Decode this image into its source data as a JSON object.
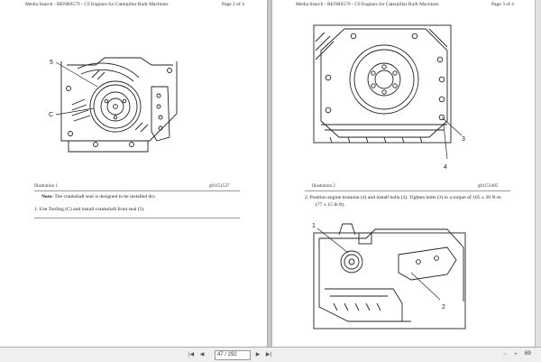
{
  "left_page": {
    "header_left": "Media Search - RENR9579 - C9 Engines for Caterpillar Built Machines",
    "header_right": "Page 2 of 4",
    "illustration": {
      "label": "Illustration 1",
      "id": "g01151537",
      "callouts": [
        "5",
        "C"
      ]
    },
    "note_label": "Note:",
    "note_text": " The crankshaft seal is designed to be installed dry.",
    "step": "1.  Use Tooling (C) and install crankshaft front seal (5)."
  },
  "right_page": {
    "header_left": "Media Search - RENR9579 - C9 Engines for Caterpillar Built Machines",
    "header_right": "Page 3 of 4",
    "illustration_top": {
      "label": "Illustration 2",
      "id": "g01151405",
      "callouts": [
        "3",
        "4"
      ]
    },
    "step_line1": "2.  Position engine trunnion (4) and install bolts (3). Tighten bolts (3) to a torque of 105 ± 20 N·m",
    "step_line2": "(77 ± 15 lb ft).",
    "illustration_bottom": {
      "callouts": [
        "1",
        "2"
      ]
    }
  },
  "toolbar": {
    "page_field": "47 / 292",
    "zoom": "69"
  },
  "colors": {
    "background": "#c8c8c8",
    "page": "#ffffff",
    "line_art": "#222222"
  }
}
